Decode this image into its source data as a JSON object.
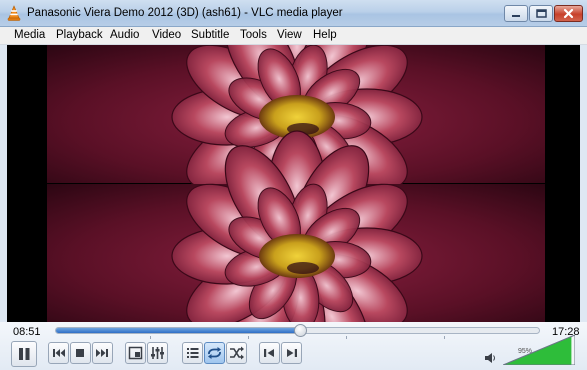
{
  "window": {
    "title": "Panasonic Viera Demo 2012 (3D) (ash61) - VLC media player"
  },
  "menu": {
    "items": [
      "Media",
      "Playback",
      "Audio",
      "Video",
      "Subtitle",
      "Tools",
      "View",
      "Help"
    ]
  },
  "player": {
    "elapsed": "08:51",
    "total": "17:28",
    "progress": 0.506,
    "volume_label": "95%",
    "volume": 0.95
  },
  "icons": {
    "app": "vlc-cone-icon",
    "minimize": "minimize-icon",
    "maximize": "maximize-icon",
    "close": "close-icon",
    "pause": "pause-icon",
    "previous": "skip-previous-icon",
    "stop": "stop-icon",
    "next": "skip-next-icon",
    "fullscreen": "fullscreen-icon",
    "extended": "extended-settings-icon",
    "playlist": "playlist-icon",
    "loop": "loop-icon",
    "shuffle": "shuffle-icon",
    "frame_back": "frame-back-icon",
    "frame_forward": "frame-forward-icon",
    "speaker": "speaker-icon"
  },
  "colors": {
    "seek_fill": "#2f6fc6",
    "volume_fill": "#2ebd3a",
    "video_bg": "#000000"
  }
}
